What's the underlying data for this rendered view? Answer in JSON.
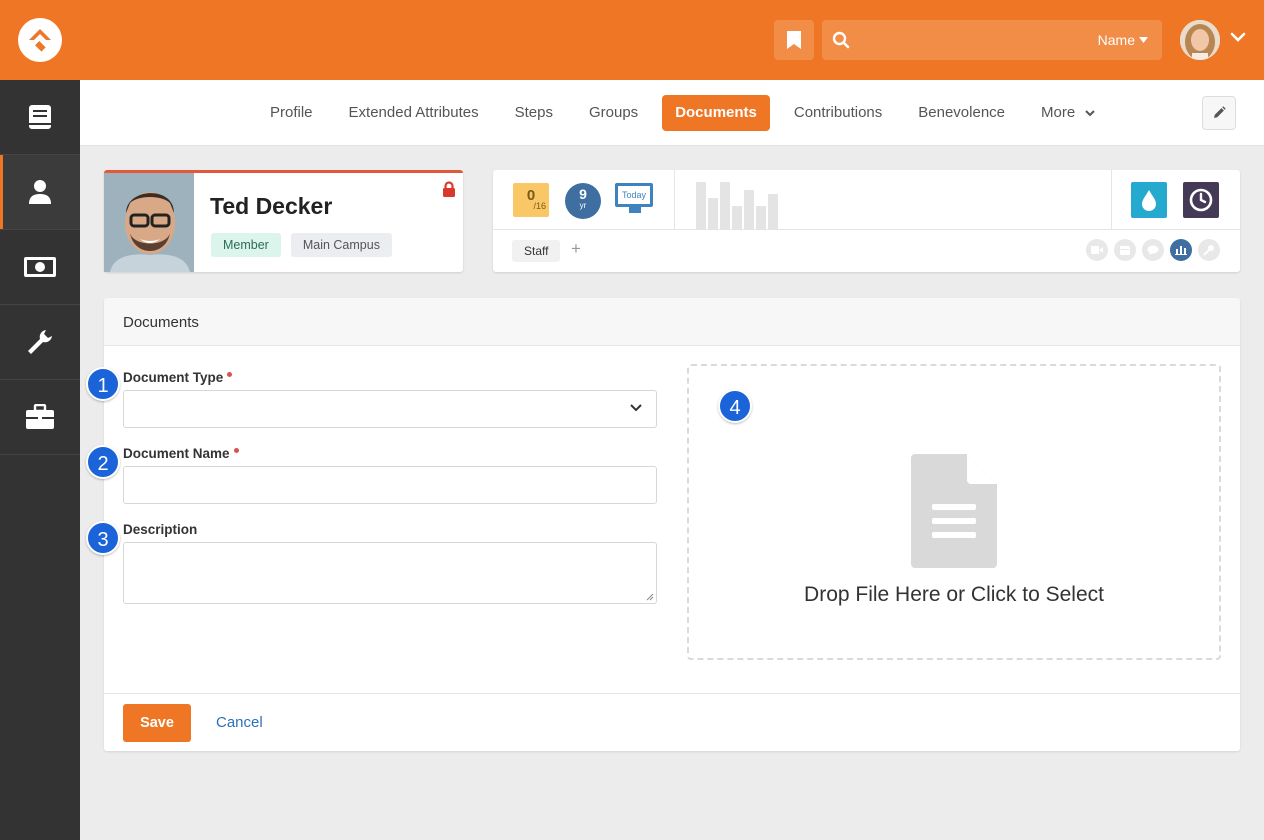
{
  "header": {
    "search_filter_label": "Name",
    "colors": {
      "brand": "#ee7625",
      "sidebar": "#333333",
      "accent_blue": "#1a63d8"
    }
  },
  "sidebar": {
    "items": [
      {
        "name": "book-icon"
      },
      {
        "name": "person-icon",
        "active": true
      },
      {
        "name": "money-icon"
      },
      {
        "name": "wrench-icon"
      },
      {
        "name": "briefcase-icon"
      }
    ]
  },
  "tabs": [
    {
      "label": "Profile"
    },
    {
      "label": "Extended Attributes"
    },
    {
      "label": "Steps"
    },
    {
      "label": "Groups"
    },
    {
      "label": "Documents",
      "active": true
    },
    {
      "label": "Contributions"
    },
    {
      "label": "Benevolence"
    },
    {
      "label": "More"
    }
  ],
  "person": {
    "name": "Ted Decker",
    "badges": [
      "Member",
      "Main Campus"
    ]
  },
  "badge_bar": {
    "ratio_value": "0",
    "ratio_total": "/16",
    "years_value": "9",
    "years_unit": "yr",
    "today_label": "Today",
    "tag": "Staff",
    "add_tag": "+",
    "attendance_bars": [
      48,
      32,
      48,
      24,
      40,
      24,
      36
    ]
  },
  "form": {
    "title": "Documents",
    "document_type_label": "Document Type",
    "document_name_label": "Document Name",
    "description_label": "Description",
    "dropzone_text": "Drop File Here or Click to Select",
    "callouts": [
      "1",
      "2",
      "3",
      "4"
    ],
    "save_label": "Save",
    "cancel_label": "Cancel"
  }
}
